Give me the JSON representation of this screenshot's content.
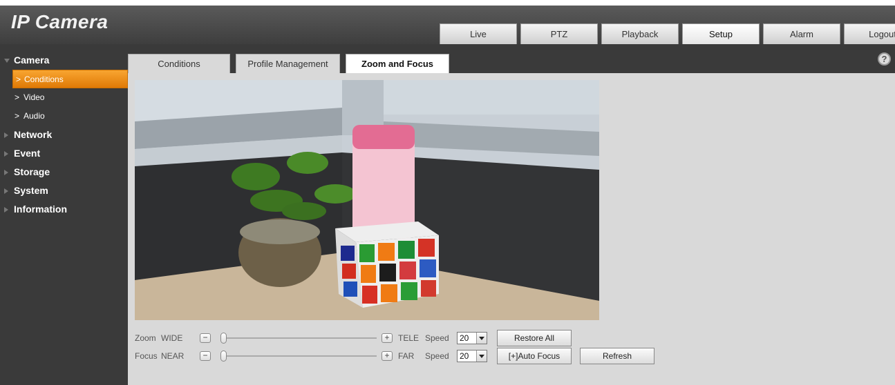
{
  "app": {
    "logo": "IP Camera"
  },
  "nav": {
    "tabs": [
      {
        "label": "Live"
      },
      {
        "label": "PTZ"
      },
      {
        "label": "Playback"
      },
      {
        "label": "Setup"
      },
      {
        "label": "Alarm"
      },
      {
        "label": "Logout"
      }
    ],
    "active": "Setup"
  },
  "sidebar": {
    "camera": "Camera",
    "items": [
      {
        "label": "Conditions"
      },
      {
        "label": "Video"
      },
      {
        "label": "Audio"
      }
    ],
    "groups": [
      {
        "label": "Network"
      },
      {
        "label": "Event"
      },
      {
        "label": "Storage"
      },
      {
        "label": "System"
      },
      {
        "label": "Information"
      }
    ]
  },
  "subtabs": [
    {
      "label": "Conditions"
    },
    {
      "label": "Profile Management"
    },
    {
      "label": "Zoom and Focus"
    }
  ],
  "help_icon": "?",
  "controls": {
    "zoom": {
      "label": "Zoom",
      "min_label": "WIDE",
      "max_label": "TELE",
      "minus": "−",
      "plus": "+",
      "speed_label": "Speed",
      "speed_value": "20",
      "level": 0
    },
    "focus": {
      "label": "Focus",
      "min_label": "NEAR",
      "max_label": "FAR",
      "minus": "−",
      "plus": "+",
      "speed_label": "Speed",
      "speed_value": "20",
      "level": 0
    },
    "restore_all": "Restore All",
    "auto_focus_icon": "[+]",
    "auto_focus": "Auto Focus",
    "refresh": "Refresh"
  },
  "colors": {
    "accent": "#f08a12",
    "header_bg": "#4a4a4a",
    "panel_bg": "#d9d9d9"
  }
}
